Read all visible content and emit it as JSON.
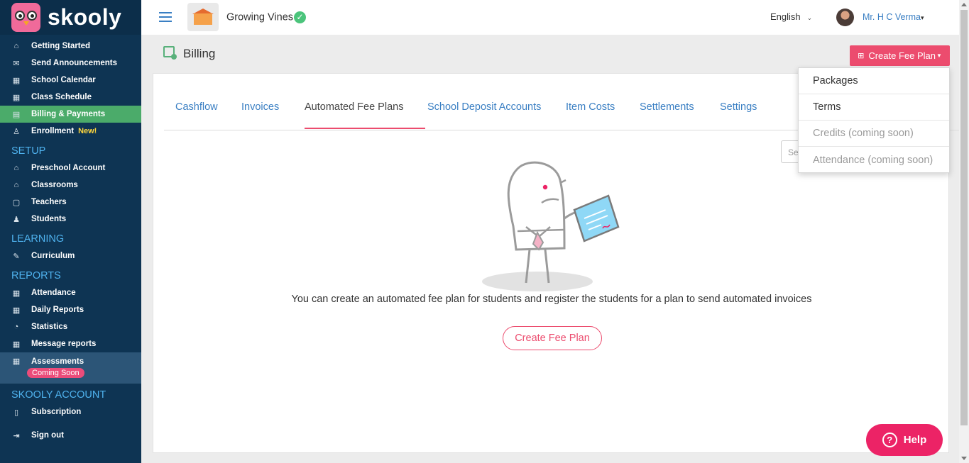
{
  "brand": {
    "name": "skooly"
  },
  "sidebar": {
    "items_top": [
      {
        "label": "Getting Started",
        "icon": "⌂"
      },
      {
        "label": "Send Announcements",
        "icon": "✉"
      },
      {
        "label": "School Calendar",
        "icon": "▦"
      },
      {
        "label": "Class Schedule",
        "icon": "▦"
      },
      {
        "label": "Billing & Payments",
        "icon": "▤"
      },
      {
        "label": "Enrollment",
        "icon": "♙",
        "badge": "New!"
      }
    ],
    "setup_heading": "SETUP",
    "setup_items": [
      {
        "label": "Preschool Account",
        "icon": "⌂"
      },
      {
        "label": "Classrooms",
        "icon": "⌂"
      },
      {
        "label": "Teachers",
        "icon": "▢"
      },
      {
        "label": "Students",
        "icon": "♟"
      }
    ],
    "learning_heading": "LEARNING",
    "learning_items": [
      {
        "label": "Curriculum",
        "icon": "✎"
      }
    ],
    "reports_heading": "REPORTS",
    "reports_items": [
      {
        "label": "Attendance",
        "icon": "▦"
      },
      {
        "label": "Daily Reports",
        "icon": "▦"
      },
      {
        "label": "Statistics",
        "icon": "◔"
      },
      {
        "label": "Message reports",
        "icon": "▦"
      }
    ],
    "assessments": {
      "label": "Assessments",
      "badge": "Coming Soon",
      "icon": "▦"
    },
    "account_heading": "SKOOLY ACCOUNT",
    "account_items": [
      {
        "label": "Subscription",
        "icon": "▯"
      }
    ],
    "signout": {
      "label": "Sign out",
      "icon": "⇥"
    }
  },
  "topbar": {
    "school_name": "Growing Vines",
    "verified_icon": "✓",
    "language": "English",
    "user_name": "Mr. H C Verma"
  },
  "page": {
    "title": "Billing",
    "create_button": "Create Fee Plan",
    "tabs": [
      "Cashflow",
      "Invoices",
      "Automated Fee Plans",
      "School Deposit Accounts",
      "Item Costs",
      "Settlements",
      "Settings"
    ],
    "active_tab": "Automated Fee Plans",
    "search_placeholder": "Sea",
    "empty_message": "You can create an automated fee plan for students and register the students for a plan to send automated invoices",
    "empty_button": "Create Fee Plan"
  },
  "dropdown": {
    "items": [
      {
        "label": "Packages",
        "enabled": true
      },
      {
        "label": "Terms",
        "enabled": true
      },
      {
        "label": "Credits (coming soon)",
        "enabled": false
      },
      {
        "label": "Attendance (coming soon)",
        "enabled": false
      }
    ]
  },
  "help": {
    "label": "Help"
  },
  "colors": {
    "sidebar_bg": "#0e3453",
    "active_green": "#4bab6a",
    "accent_pink": "#ec4c6e",
    "link_blue": "#3a7fc3",
    "section_blue": "#4fb2ee"
  }
}
